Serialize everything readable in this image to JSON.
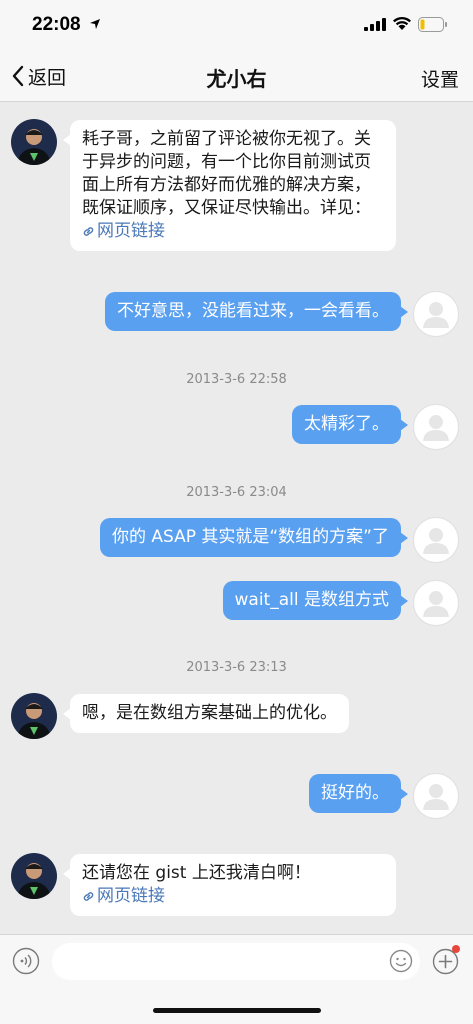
{
  "status_bar": {
    "time": "22:08"
  },
  "nav": {
    "back_label": "返回",
    "title": "尤小右",
    "settings_label": "设置"
  },
  "messages": [
    {
      "from": "other",
      "text": "耗子哥，之前留了评论被你无视了。关于异步的问题，有一个比你目前测试页面上所有方法都好而优雅的解决方案，既保证顺序，又保证尽快输出。详见：",
      "link": "网页链接"
    },
    {
      "from": "me",
      "text": "不好意思，没能看过来，一会看看。"
    },
    {
      "timestamp": "2013-3-6 22:58"
    },
    {
      "from": "me",
      "text": "太精彩了。"
    },
    {
      "timestamp": "2013-3-6 23:04"
    },
    {
      "from": "me",
      "text": "你的 ASAP 其实就是“数组的方案”了"
    },
    {
      "from": "me",
      "text": "wait_all 是数组方式"
    },
    {
      "timestamp": "2013-3-6 23:13"
    },
    {
      "from": "other",
      "text": "嗯，是在数组方案基础上的优化。"
    },
    {
      "from": "me",
      "text": "挺好的。"
    },
    {
      "from": "other",
      "text": "还请您在 gist 上还我清白啊！",
      "link": "网页链接"
    }
  ],
  "colors": {
    "out_bubble": "#5aa0f0",
    "in_bubble": "#ffffff",
    "link": "#4a78b8",
    "background": "#ebebeb",
    "badge": "#e8453c"
  },
  "icons": [
    "location-arrow-icon",
    "signal-icon",
    "wifi-icon",
    "battery-icon",
    "back-chevron-icon",
    "link-icon",
    "voice-icon",
    "emoji-icon",
    "plus-icon"
  ]
}
